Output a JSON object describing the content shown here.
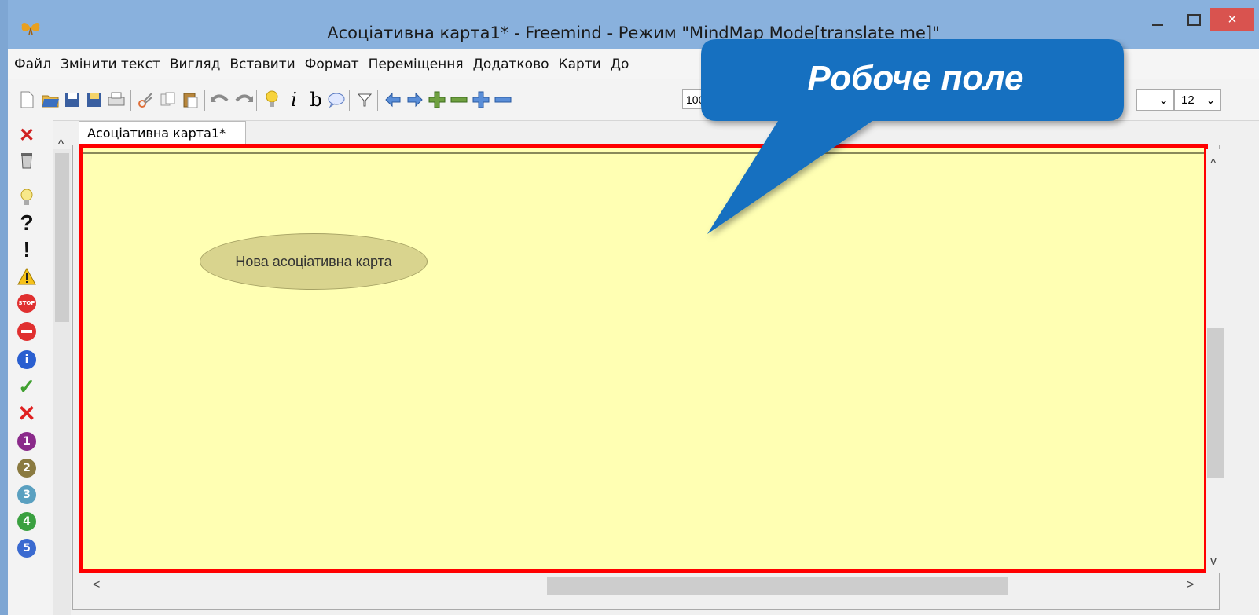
{
  "window": {
    "title": "Асоціативна карта1* - Freemind - Режим \"MindMap Mode[translate me]\"",
    "close_glyph": "×"
  },
  "menu": {
    "items": [
      "Файл",
      "Змінити текст",
      "Вигляд",
      "Вставити",
      "Формат",
      "Переміщення",
      "Додатково",
      "Карти",
      "До"
    ]
  },
  "toolbar": {
    "zoom_value": "100",
    "font_size": "12",
    "icons": [
      "new-icon",
      "open-icon",
      "save-icon",
      "save-as-icon",
      "print-icon",
      "cut-icon",
      "copy-icon",
      "paste-icon",
      "undo-icon",
      "redo-icon",
      "idea-bulb-icon",
      "italic-icon",
      "bold-icon",
      "cloud-icon",
      "filter-icon",
      "arrow-left-icon",
      "arrow-right-icon",
      "green-plus-icon",
      "green-minus-icon",
      "blue-plus-icon",
      "blue-minus-icon"
    ]
  },
  "tab": {
    "label": "Асоціативна карта1*"
  },
  "map": {
    "root_node": "Нова асоціативна карта"
  },
  "callout": {
    "text": "Робоче поле",
    "color": "#1270c0"
  },
  "highlight_color": "#ff0000",
  "canvas_color": "#ffffb3",
  "sidebar_icons": [
    "remove-icon",
    "trash-icon",
    "idea-icon",
    "question-icon",
    "exclamation-icon",
    "warning-icon",
    "stop-icon",
    "no-entry-icon",
    "info-icon",
    "check-icon",
    "cross-icon",
    "priority-1-icon",
    "priority-2-icon",
    "priority-3-icon",
    "priority-4-icon",
    "priority-5-icon"
  ],
  "priority_labels": [
    "1",
    "2",
    "3",
    "4",
    "5"
  ]
}
